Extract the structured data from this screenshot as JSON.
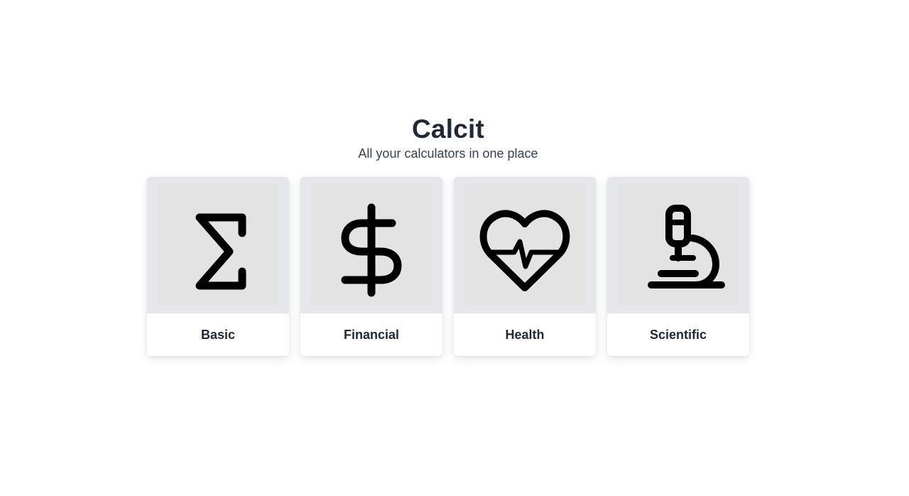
{
  "header": {
    "title": "Calcit",
    "subtitle": "All your calculators in one place"
  },
  "cards": [
    {
      "label": "Basic",
      "icon": "sigma-icon"
    },
    {
      "label": "Financial",
      "icon": "dollar-icon"
    },
    {
      "label": "Health",
      "icon": "heart-pulse-icon"
    },
    {
      "label": "Scientific",
      "icon": "microscope-icon"
    }
  ],
  "colors": {
    "text": "#1f2937",
    "card_top": "#e5e7eb",
    "icon_bg": "#e3e3e3",
    "icon_stroke": "#000000"
  }
}
